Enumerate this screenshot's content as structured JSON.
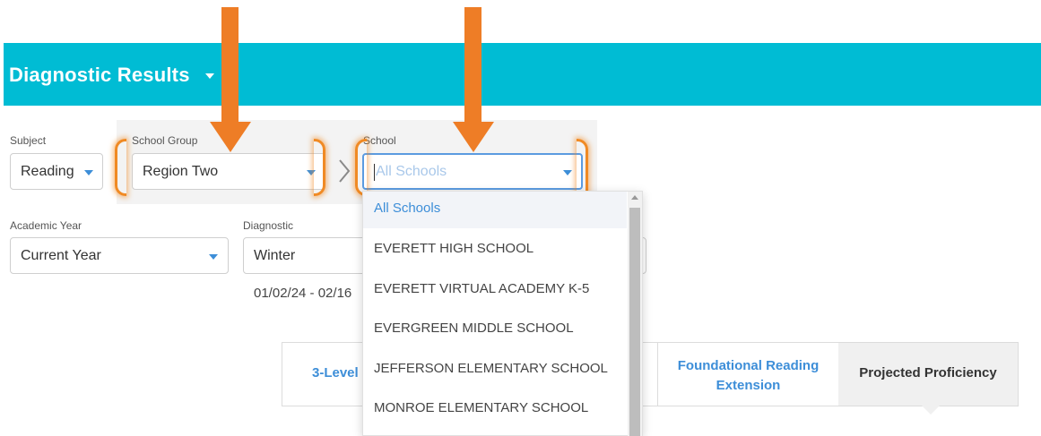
{
  "header": {
    "title": "Diagnostic Results"
  },
  "filters": {
    "subject": {
      "label": "Subject",
      "value": "Reading"
    },
    "school_group": {
      "label": "School Group",
      "value": "Region Two"
    },
    "school": {
      "label": "School",
      "placeholder": "All Schools"
    },
    "academic_year": {
      "label": "Academic Year",
      "value": "Current Year"
    },
    "diagnostic": {
      "label": "Diagnostic",
      "value": "Winter",
      "date_range": "01/02/24 - 02/16"
    }
  },
  "school_dropdown": {
    "options": [
      "All Schools",
      "EVERETT HIGH SCHOOL",
      "EVERETT VIRTUAL ACADEMY K-5",
      "EVERGREEN MIDDLE SCHOOL",
      "JEFFERSON ELEMENTARY SCHOOL",
      "MONROE ELEMENTARY SCHOOL"
    ],
    "selected_index": 0
  },
  "tabs": [
    {
      "label": "3-Level"
    },
    {
      "label_line1": "Foundational Reading",
      "label_line2": "Extension"
    },
    {
      "label": "Projected Proficiency",
      "active": true
    }
  ],
  "colors": {
    "header": "#00bcd4",
    "accent": "#3d8ed8",
    "annotation": "#ee7d26"
  }
}
